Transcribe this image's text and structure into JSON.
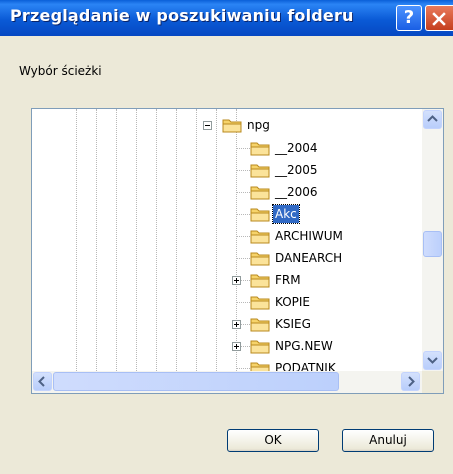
{
  "dialog": {
    "title": "Przeglądanie w poszukiwaniu folderu",
    "help_glyph": "?",
    "instruction": "Wybór ścieżki",
    "ok_label": "OK",
    "cancel_label": "Anuluj"
  },
  "tree": {
    "root": {
      "label": "npg",
      "state": "expanded"
    },
    "items": [
      {
        "label": "__2004",
        "expander": "none",
        "selected": false
      },
      {
        "label": "__2005",
        "expander": "none",
        "selected": false
      },
      {
        "label": "__2006",
        "expander": "none",
        "selected": false
      },
      {
        "label": "Akc",
        "expander": "none",
        "selected": true
      },
      {
        "label": "ARCHIWUM",
        "expander": "none",
        "selected": false
      },
      {
        "label": "DANEARCH",
        "expander": "none",
        "selected": false
      },
      {
        "label": "FRM",
        "expander": "plus",
        "selected": false
      },
      {
        "label": "KOPIE",
        "expander": "none",
        "selected": false
      },
      {
        "label": "KSIEG",
        "expander": "plus",
        "selected": false
      },
      {
        "label": "NPG.NEW",
        "expander": "plus",
        "selected": false
      },
      {
        "label": "PODATNIK",
        "expander": "none",
        "selected": false
      }
    ]
  },
  "colors": {
    "titlebar": "#0a5ad6",
    "selection": "#316ac5",
    "folder": "#f6d36a",
    "close": "#c53e1d"
  },
  "icons": [
    "help-icon",
    "close-icon",
    "folder-icon",
    "expand-icon",
    "collapse-icon",
    "scroll-up-icon",
    "scroll-down-icon",
    "scroll-left-icon",
    "scroll-right-icon"
  ]
}
